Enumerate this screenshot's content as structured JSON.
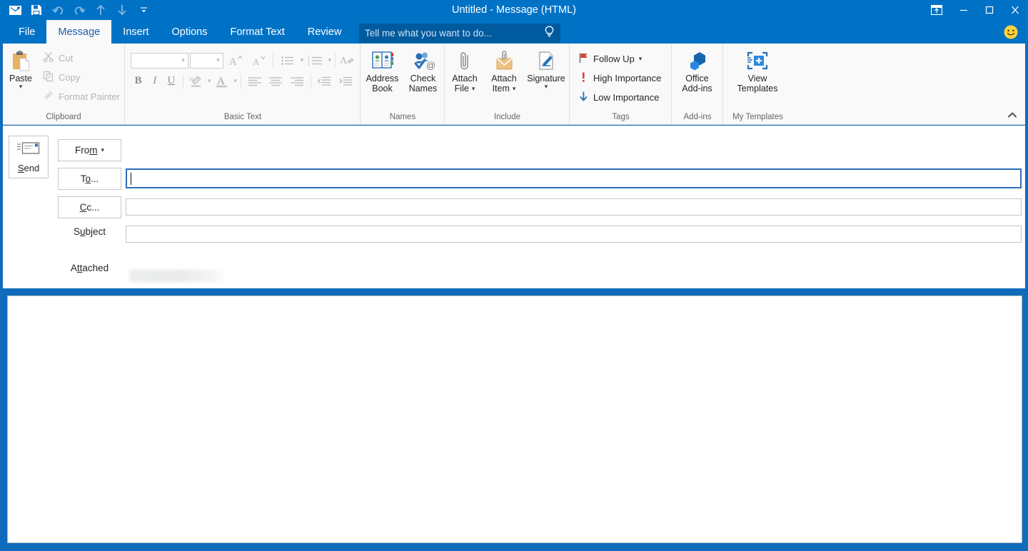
{
  "window": {
    "title": "Untitled - Message (HTML)",
    "accent_color": "#0072c6",
    "quick_access": [
      {
        "name": "message-icon",
        "label": "New Message"
      },
      {
        "name": "save-icon",
        "label": "Save"
      },
      {
        "name": "undo-icon",
        "label": "Undo"
      },
      {
        "name": "redo-icon",
        "label": "Redo"
      },
      {
        "name": "previous-item-icon",
        "label": "Previous Item"
      },
      {
        "name": "next-item-icon",
        "label": "Next Item"
      },
      {
        "name": "customize-quick-access-icon",
        "label": "Customize Quick Access Toolbar"
      }
    ],
    "controls": [
      {
        "name": "ribbon-display-options",
        "label": "Ribbon Display Options"
      },
      {
        "name": "minimize",
        "label": "Minimize"
      },
      {
        "name": "maximize",
        "label": "Maximize"
      },
      {
        "name": "close",
        "label": "Close"
      }
    ],
    "feedback_icon": "smiley-face-icon"
  },
  "tabs": [
    {
      "label": "File",
      "active": false
    },
    {
      "label": "Message",
      "active": true
    },
    {
      "label": "Insert",
      "active": false
    },
    {
      "label": "Options",
      "active": false
    },
    {
      "label": "Format Text",
      "active": false
    },
    {
      "label": "Review",
      "active": false
    }
  ],
  "tell_me": {
    "placeholder": "Tell me what you want to do...",
    "icon": "lightbulb-icon"
  },
  "ribbon": {
    "collapse_icon": "chevron-up-icon",
    "groups": [
      {
        "name": "clipboard",
        "label": "Clipboard",
        "has_dialog_launcher": true,
        "paste": {
          "label": "Paste",
          "enabled": true,
          "has_dropdown": true
        },
        "items": [
          {
            "label": "Cut",
            "icon": "scissors-icon",
            "enabled": false
          },
          {
            "label": "Copy",
            "icon": "copy-icon",
            "enabled": false
          },
          {
            "label": "Format Painter",
            "icon": "paintbrush-icon",
            "enabled": false
          }
        ]
      },
      {
        "name": "basic-text",
        "label": "Basic Text",
        "has_dialog_launcher": true,
        "font_name": "",
        "font_size": "",
        "buttons_row1": [
          "grow-font",
          "shrink-font",
          "bullets",
          "numbering",
          "clear-formatting"
        ],
        "buttons_row2": [
          "bold",
          "italic",
          "underline",
          "text-highlight-color",
          "font-color",
          "align-left",
          "align-center",
          "align-right",
          "decrease-indent",
          "increase-indent"
        ]
      },
      {
        "name": "names",
        "label": "Names",
        "items": [
          {
            "label_line1": "Address",
            "label_line2": "Book",
            "icon": "address-book-icon",
            "has_dropdown": false
          },
          {
            "label_line1": "Check",
            "label_line2": "Names",
            "icon": "check-names-icon",
            "has_dropdown": false
          }
        ]
      },
      {
        "name": "include",
        "label": "Include",
        "items": [
          {
            "label_line1": "Attach",
            "label_line2": "File",
            "icon": "paperclip-icon",
            "has_dropdown": true
          },
          {
            "label_line1": "Attach",
            "label_line2": "Item",
            "icon": "attach-item-icon",
            "has_dropdown": true
          },
          {
            "label_line1": "Signature",
            "label_line2": "",
            "icon": "signature-icon",
            "has_dropdown": true
          }
        ]
      },
      {
        "name": "tags",
        "label": "Tags",
        "has_dialog_launcher": true,
        "items": [
          {
            "label": "Follow Up",
            "icon": "flag-icon",
            "has_dropdown": true
          },
          {
            "label": "High Importance",
            "icon": "exclamation-icon",
            "has_dropdown": false
          },
          {
            "label": "Low Importance",
            "icon": "down-arrow-icon",
            "has_dropdown": false
          }
        ]
      },
      {
        "name": "add-ins",
        "label": "Add-ins",
        "items": [
          {
            "label_line1": "Office",
            "label_line2": "Add-ins",
            "icon": "office-addins-icon",
            "has_dropdown": false
          }
        ]
      },
      {
        "name": "my-templates",
        "label": "My Templates",
        "items": [
          {
            "label_line1": "View",
            "label_line2": "Templates",
            "icon": "view-templates-icon",
            "has_dropdown": false
          }
        ]
      }
    ]
  },
  "compose": {
    "send_button": {
      "label": "Send",
      "icon": "send-envelope-icon"
    },
    "from_button": {
      "label": "From",
      "has_dropdown": true
    },
    "from_value": "",
    "to_button": {
      "label": "To..."
    },
    "to_value": "",
    "to_focused": true,
    "cc_button": {
      "label": "Cc..."
    },
    "cc_value": "",
    "subject_label": "Subject",
    "subject_value": "",
    "attached_label": "Attached",
    "attachment": {
      "name": "What is New in Outloo...",
      "permission": "Anyone can edit",
      "icon": "word-document-cloud-icon",
      "has_dropdown": true
    },
    "body_value": ""
  }
}
